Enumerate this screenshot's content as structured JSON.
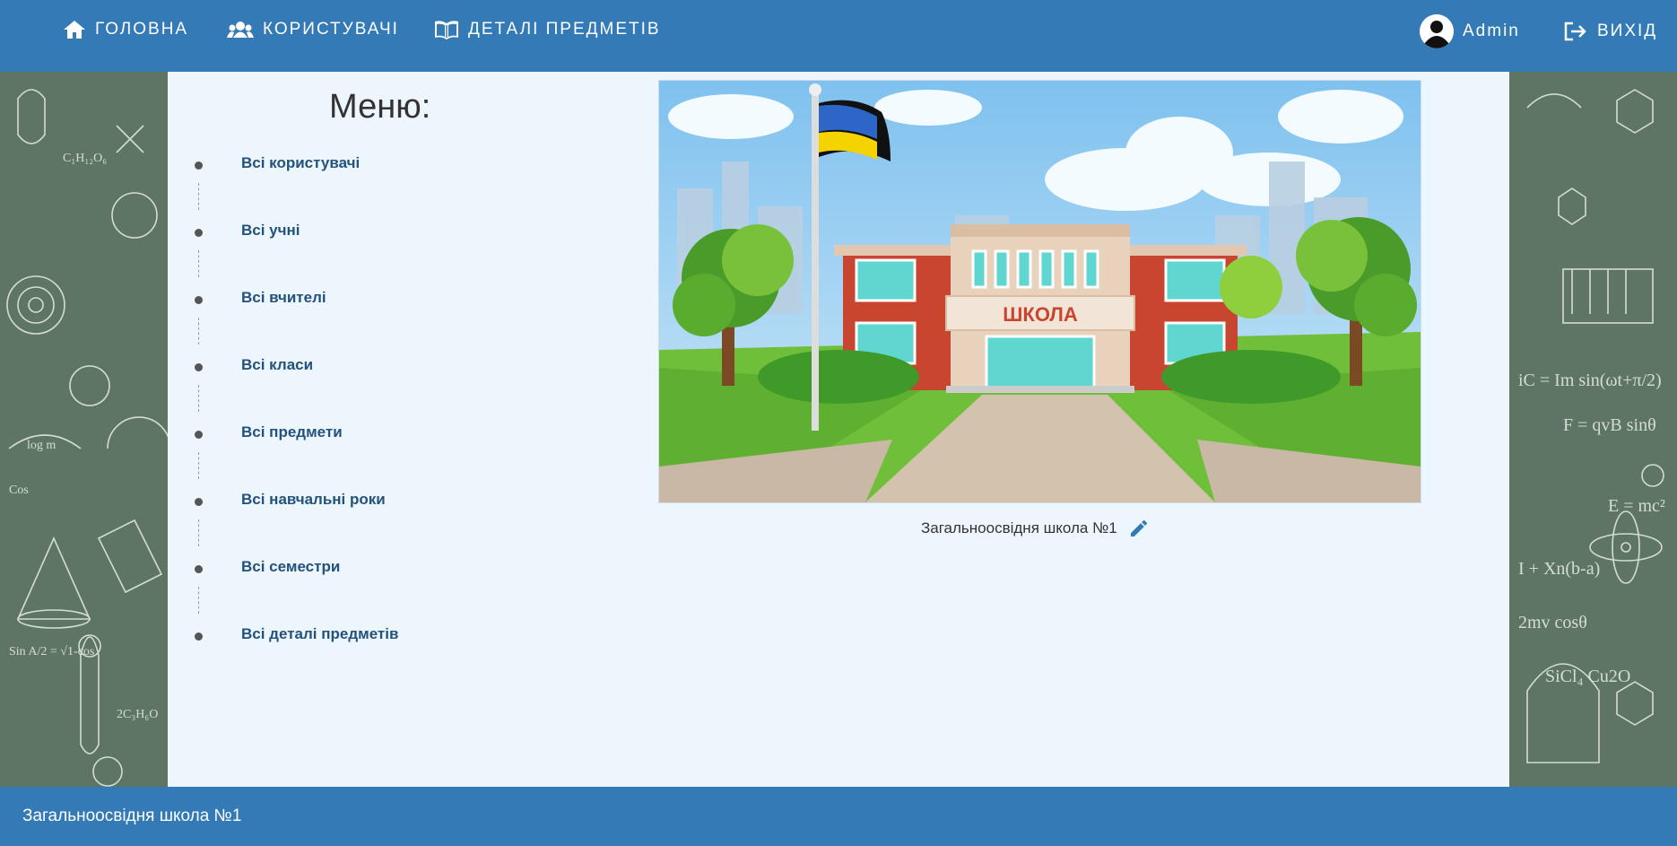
{
  "nav": {
    "home": "ГОЛОВНА",
    "users": "КОРИСТУВАЧІ",
    "subject_details": "ДЕТАЛІ ПРЕДМЕТІВ",
    "user": "Admin",
    "logout": "ВИХІД",
    "icons": [
      "home-icon",
      "users-icon",
      "book-icon",
      "avatar-icon",
      "logout-icon"
    ]
  },
  "menu": {
    "title": "Меню:",
    "items": [
      {
        "label": "Всі користувачі"
      },
      {
        "label": "Всі учні"
      },
      {
        "label": "Всі вчителі"
      },
      {
        "label": "Всі класи"
      },
      {
        "label": "Всі предмети"
      },
      {
        "label": "Всі навчальні роки"
      },
      {
        "label": "Всі семестри"
      },
      {
        "label": "Всі деталі предметів"
      }
    ]
  },
  "school": {
    "sign": "ШКОЛА",
    "caption": "Загальноосвідня школа №1"
  },
  "footer": {
    "text": "Загальноосвідня школа №1"
  },
  "colors": {
    "primary": "#337ab7",
    "content_bg": "#eef6fd",
    "chalkboard": "#5f7563",
    "link": "#23527c"
  }
}
